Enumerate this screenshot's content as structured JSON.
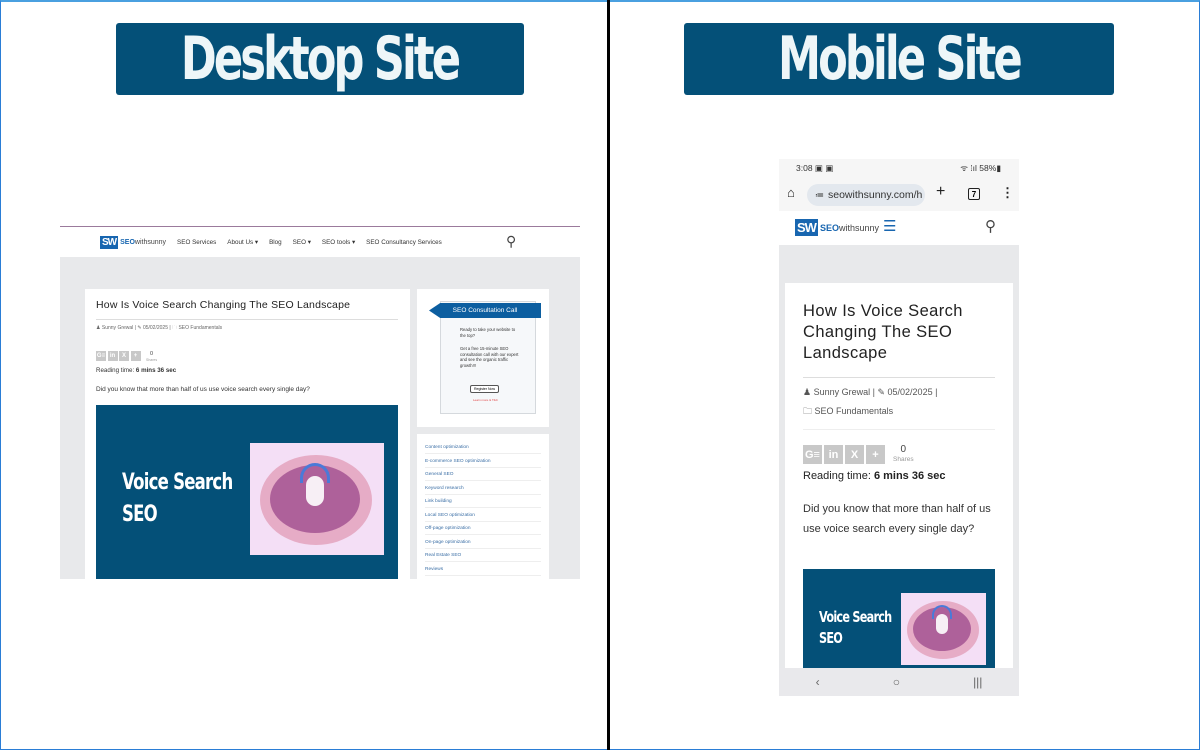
{
  "labels": {
    "desktop": "Desktop Site",
    "mobile": "Mobile Site"
  },
  "colors": {
    "banner": "#045078",
    "brand_blue": "#1866b0",
    "ribbon": "#0c5ea0"
  },
  "site": {
    "logo_mark": "SW",
    "logo_seo": "SEO",
    "logo_rest": "withsunny",
    "nav": [
      "SEO Services",
      "About Us ▾",
      "Blog",
      "SEO ▾",
      "SEO tools ▾",
      "SEO Consultancy Services"
    ],
    "search_icon": "search-icon"
  },
  "article": {
    "title": "How Is Voice Search Changing The SEO Landscape",
    "author": "Sunny Grewal",
    "date": "05/02/2025",
    "category": "SEO Fundamentals",
    "share_buttons": [
      "G≡",
      "in",
      "X",
      "+"
    ],
    "share_count": "0",
    "share_label": "Shares",
    "reading_label": "Reading time:",
    "reading_value": "6 mins 36 sec",
    "intro": "Did you know that more than half of us use voice search every single day?",
    "hero_line1": "Voice Search",
    "hero_line2": "SEO"
  },
  "sidebar": {
    "consult_title": "SEO Consultation Call",
    "consult_p1": "Ready to take your website to the top?",
    "consult_p2": "Get a free 15-minute SEO consultation call with our expert and see the organic traffic growth!!!",
    "consult_button": "Register Now",
    "consult_link": "Learn more & T&C",
    "categories": [
      "Content optimization",
      "E-commerce SEO optimization",
      "General SEO",
      "Keyword research",
      "Link building",
      "Local SEO optimization",
      "Off-page optimization",
      "On-page optimization",
      "Real Estate SEO",
      "Reviews"
    ]
  },
  "mobile": {
    "time": "3:08",
    "status_icons": "▣ ▣",
    "battery": "58%",
    "signal": "ᯤ ⁞ıl",
    "url": "seowithsunny.com/h",
    "tab_count": "7",
    "nav_back": "‹",
    "nav_home": "○",
    "nav_recent": "|||"
  }
}
